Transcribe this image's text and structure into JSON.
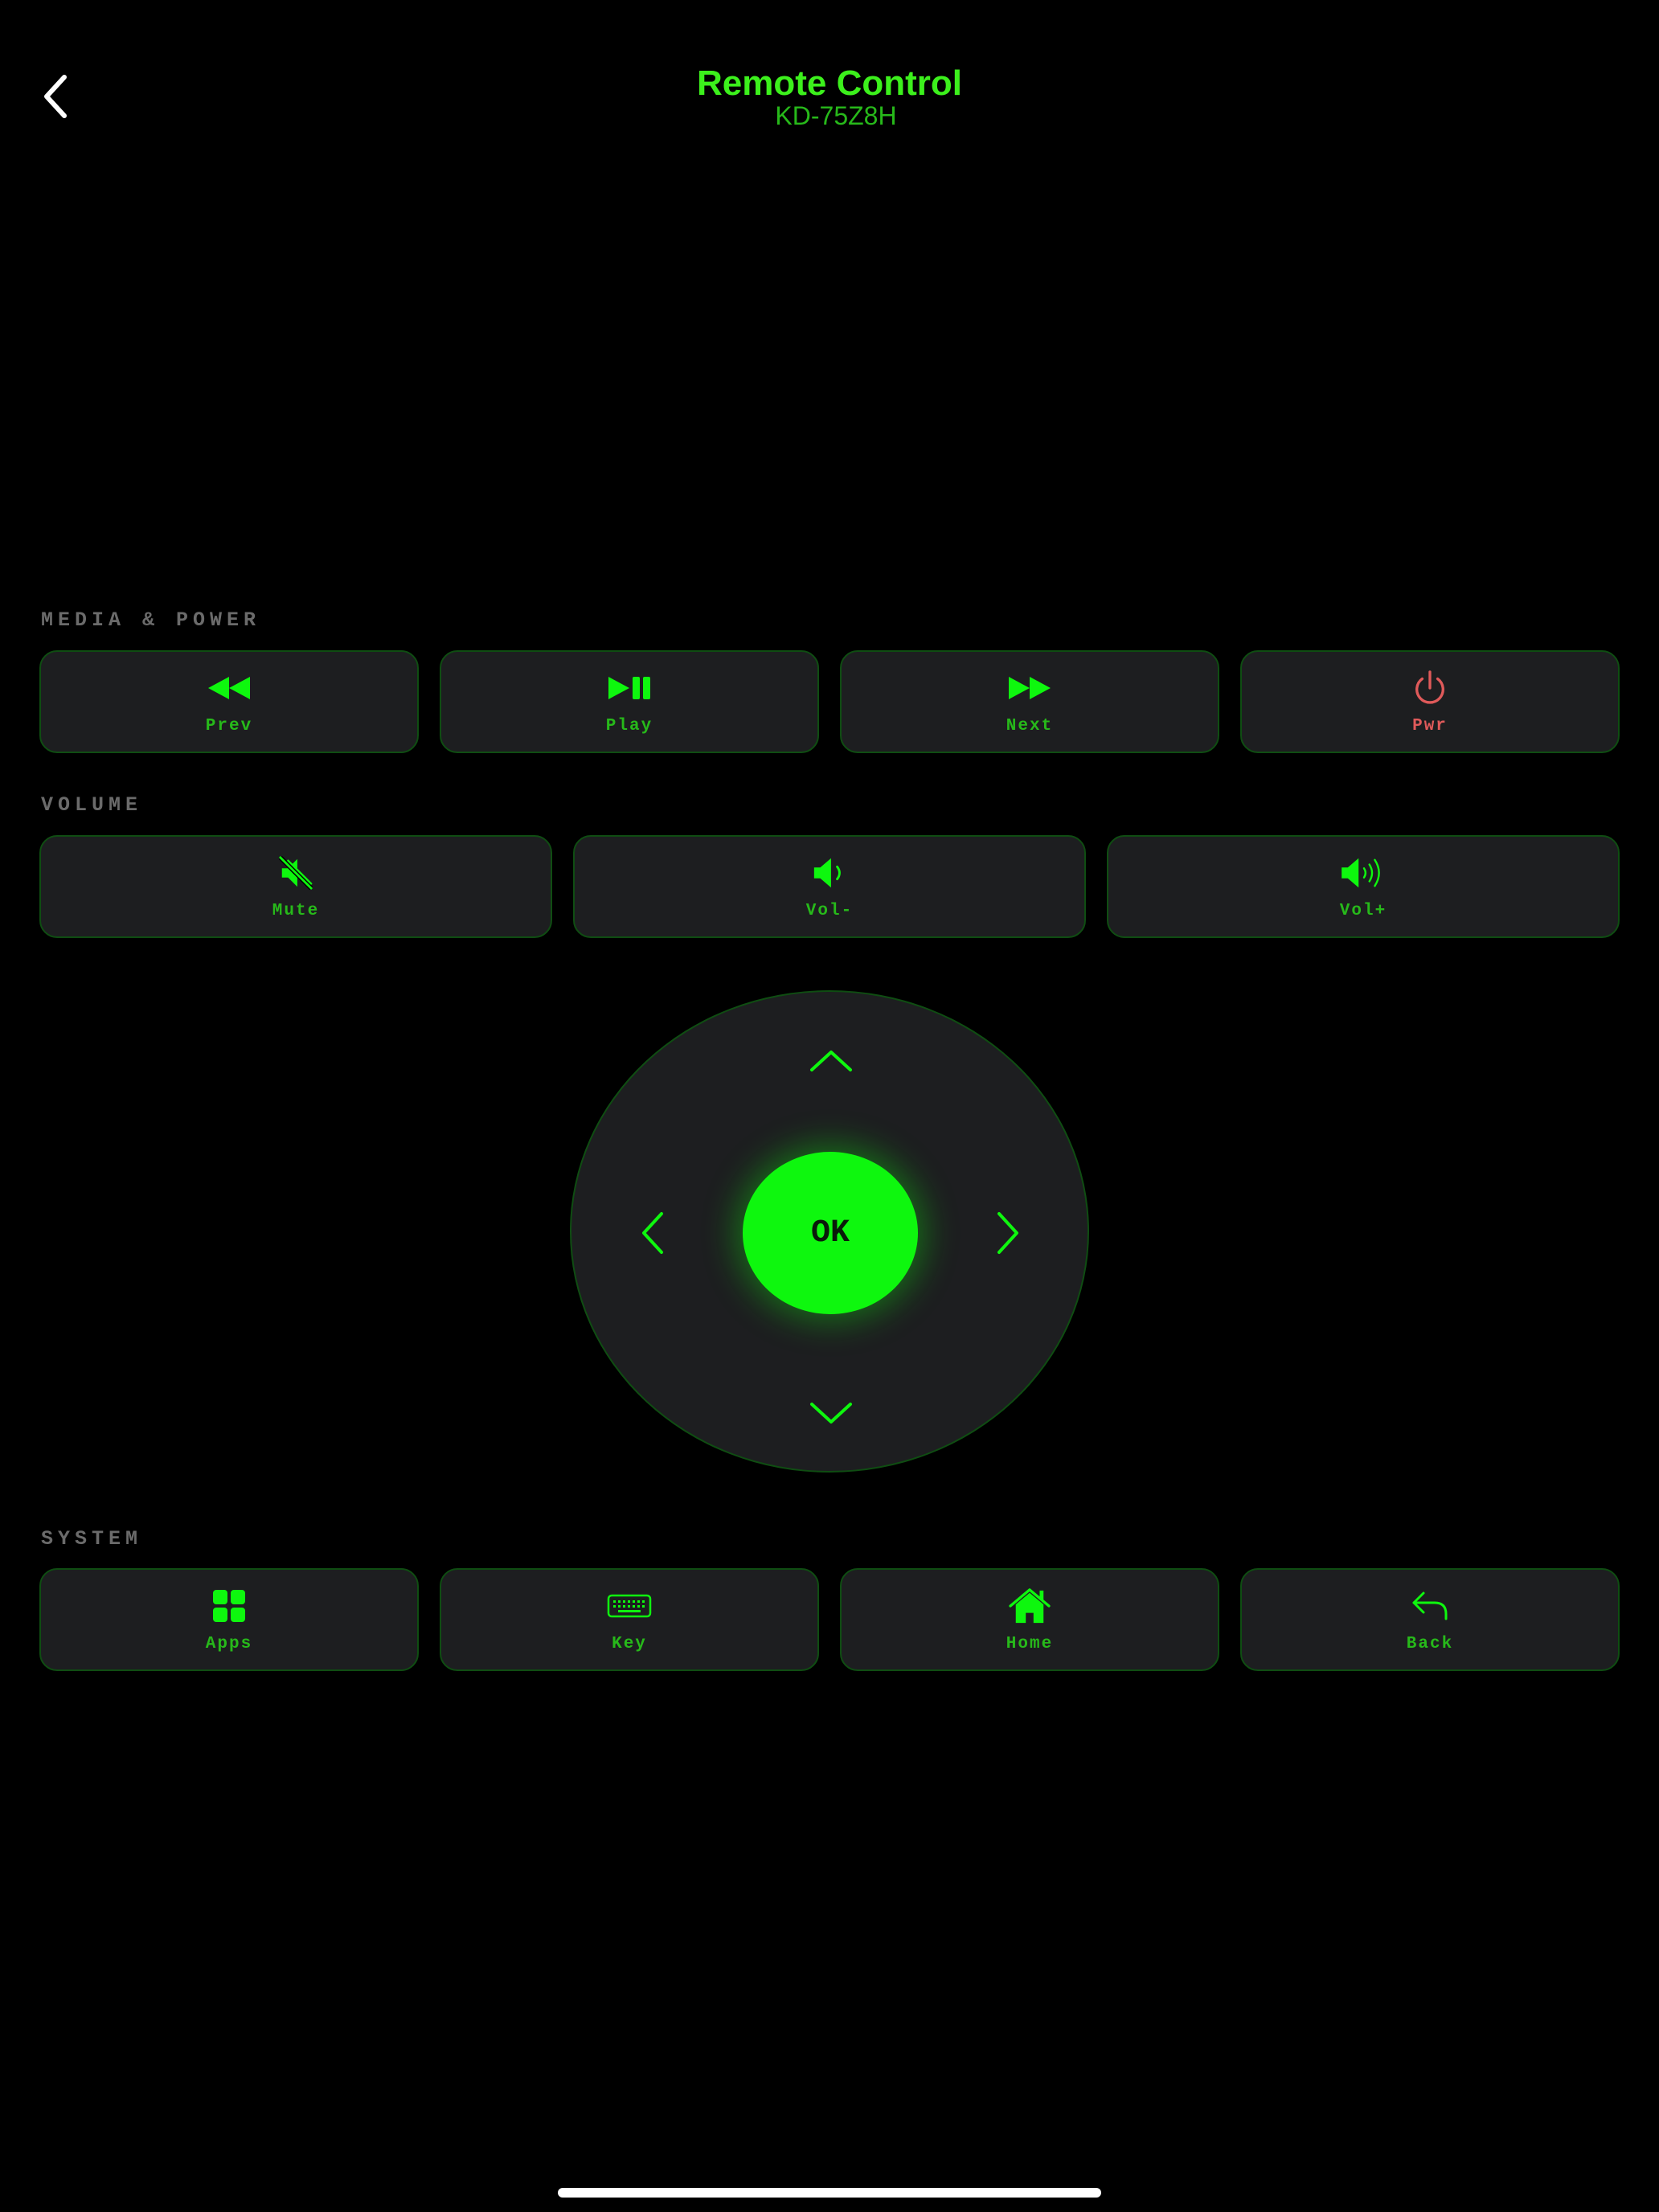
{
  "header": {
    "title": "Remote Control",
    "subtitle": "KD-75Z8H",
    "back_icon": "chevron-left-icon"
  },
  "colors": {
    "accent": "#0ef70e",
    "accent_text": "#27b91a",
    "button_bg": "#1d1e20",
    "button_border": "#0f4d12",
    "power": "#e05a5a",
    "section_label": "#6b6b6b",
    "background": "#000000"
  },
  "media_power": {
    "label": "MEDIA & POWER",
    "buttons": [
      {
        "label": "Prev",
        "icon": "rewind-icon"
      },
      {
        "label": "Play",
        "icon": "play-pause-icon"
      },
      {
        "label": "Next",
        "icon": "fast-forward-icon"
      },
      {
        "label": "Pwr",
        "icon": "power-icon"
      }
    ]
  },
  "volume": {
    "label": "VOLUME",
    "buttons": [
      {
        "label": "Mute",
        "icon": "mute-icon"
      },
      {
        "label": "Vol-",
        "icon": "volume-down-icon"
      },
      {
        "label": "Vol+",
        "icon": "volume-up-icon"
      }
    ]
  },
  "dpad": {
    "ok_label": "OK",
    "icons": [
      "chevron-up-icon",
      "chevron-left-icon",
      "chevron-right-icon",
      "chevron-down-icon"
    ]
  },
  "system": {
    "label": "SYSTEM",
    "buttons": [
      {
        "label": "Apps",
        "icon": "apps-grid-icon"
      },
      {
        "label": "Key",
        "icon": "keyboard-icon"
      },
      {
        "label": "Home",
        "icon": "home-icon"
      },
      {
        "label": "Back",
        "icon": "reply-arrow-icon"
      }
    ]
  }
}
